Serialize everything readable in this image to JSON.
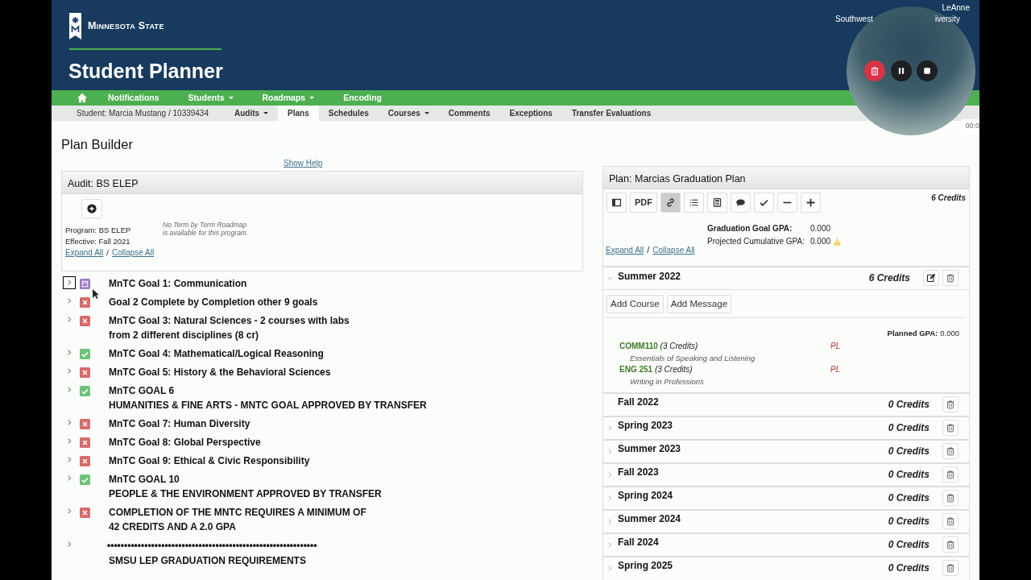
{
  "header": {
    "brand": "Minnesota State",
    "title": "Student Planner",
    "user": "LeAnne",
    "institution_left": "Southwest",
    "institution_right": "iversity"
  },
  "main_nav": [
    {
      "label": "Notifications",
      "dropdown": false
    },
    {
      "label": "Students",
      "dropdown": true
    },
    {
      "label": "Roadmaps",
      "dropdown": true
    },
    {
      "label": "Encoding",
      "dropdown": false
    }
  ],
  "student_label": "Student: Marcia Mustang / 10339434",
  "sub_nav": [
    {
      "label": "Audits",
      "dropdown": true,
      "selected": false
    },
    {
      "label": "Plans",
      "dropdown": false,
      "selected": true
    },
    {
      "label": "Schedules",
      "dropdown": false,
      "selected": false
    },
    {
      "label": "Courses",
      "dropdown": true,
      "selected": false
    },
    {
      "label": "Comments",
      "dropdown": false,
      "selected": false
    },
    {
      "label": "Exceptions",
      "dropdown": false,
      "selected": false
    },
    {
      "label": "Transfer Evaluations",
      "dropdown": false,
      "selected": false
    }
  ],
  "recorder": {
    "timer": "00:0"
  },
  "page_title": "Plan Builder",
  "show_help": "Show Help",
  "audit": {
    "title": "Audit: BS ELEP",
    "program": "Program: BS ELEP",
    "effective": "Effective: Fall 2021",
    "roadmap_note": [
      "No Term by Term Roadmap",
      "is available for this program."
    ],
    "expand_all": "Expand All",
    "collapse_all": "Collapse All",
    "separator": "/",
    "goals": [
      {
        "lines": [
          "MnTC Goal 1: Communication"
        ],
        "kind": "pending",
        "focused": true
      },
      {
        "lines": [
          "Goal 2 Complete by Completion other 9 goals"
        ],
        "kind": "unmet",
        "focused": false
      },
      {
        "lines": [
          "MnTC Goal 3: Natural Sciences - 2 courses with labs",
          "from 2 different disciplines (8 cr)"
        ],
        "kind": "unmet",
        "focused": false
      },
      {
        "lines": [
          "MnTC Goal 4: Mathematical/Logical Reasoning"
        ],
        "kind": "met",
        "focused": false
      },
      {
        "lines": [
          "MnTC Goal 5: History & the Behavioral Sciences"
        ],
        "kind": "unmet",
        "focused": false
      },
      {
        "lines": [
          "MnTC GOAL 6",
          "HUMANITIES & FINE ARTS - MNTC GOAL APPROVED BY TRANSFER"
        ],
        "kind": "met",
        "focused": false
      },
      {
        "lines": [
          "MnTC Goal 7: Human Diversity"
        ],
        "kind": "unmet",
        "focused": false
      },
      {
        "lines": [
          "MnTC Goal 8: Global Perspective"
        ],
        "kind": "unmet",
        "focused": false
      },
      {
        "lines": [
          "MnTC Goal 9: Ethical & Civic Responsibility"
        ],
        "kind": "unmet",
        "focused": false
      },
      {
        "lines": [
          "MnTC GOAL 10",
          "PEOPLE & THE ENVIRONMENT APPROVED BY TRANSFER"
        ],
        "kind": "met",
        "focused": false
      },
      {
        "lines": [
          "COMPLETION OF THE MNTC REQUIRES A MINIMUM OF",
          "42 CREDITS AND A 2.0 GPA"
        ],
        "kind": "unmet",
        "focused": false
      },
      {
        "lines": [
          "••••••••••••••••••••••••••••••••••••••••••••••••••••••••••••••",
          "SMSU LEP GRADUATION REQUIREMENTS"
        ],
        "kind": "plain",
        "focused": false
      }
    ]
  },
  "plan": {
    "title": "Plan: Marcias Graduation Plan",
    "total_credits": "6 Credits",
    "toolbar": [
      {
        "kind": "table",
        "selected": false
      },
      {
        "kind": "pdf",
        "label": "PDF",
        "selected": false
      },
      {
        "kind": "link",
        "selected": true
      },
      {
        "kind": "list",
        "selected": false
      },
      {
        "kind": "calculator",
        "selected": false
      },
      {
        "kind": "comment",
        "selected": false
      },
      {
        "kind": "check",
        "selected": false
      },
      {
        "kind": "minus",
        "selected": false
      },
      {
        "kind": "plus",
        "selected": false
      }
    ],
    "goal_gpa_label": "Graduation Goal GPA:",
    "goal_gpa": "0.000",
    "projected_gpa_label": "Projected Cumulative GPA:",
    "projected_gpa": "0.000",
    "projected_warning": true,
    "expand_all": "Expand All",
    "separator": "/",
    "collapse_all": "Collapse All",
    "terms": [
      {
        "name": "Summer 2022",
        "credits": "6 Credits",
        "expandable": true,
        "expanded": true,
        "editable": true,
        "add_course": "Add Course",
        "add_message": "Add Message",
        "planned_gpa_label": "Planned GPA:",
        "planned_gpa": "0.000",
        "courses": [
          {
            "code": "COMM110",
            "credits": "(3 Credits)",
            "title": "Essentials of Speaking and Listening",
            "grade": "PL"
          },
          {
            "code": "ENG 251",
            "credits": "(3 Credits)",
            "title": "Writing in Professions",
            "grade": "PL"
          }
        ]
      },
      {
        "name": "Fall 2022",
        "credits": "0 Credits",
        "expandable": false,
        "editable": false
      },
      {
        "name": "Spring 2023",
        "credits": "0 Credits",
        "expandable": true,
        "expanded": false,
        "editable": false
      },
      {
        "name": "Summer 2023",
        "credits": "0 Credits",
        "expandable": true,
        "expanded": false,
        "editable": false
      },
      {
        "name": "Fall 2023",
        "credits": "0 Credits",
        "expandable": true,
        "expanded": false,
        "editable": false
      },
      {
        "name": "Spring 2024",
        "credits": "0 Credits",
        "expandable": true,
        "expanded": false,
        "editable": false
      },
      {
        "name": "Summer 2024",
        "credits": "0 Credits",
        "expandable": true,
        "expanded": false,
        "editable": false
      },
      {
        "name": "Fall 2024",
        "credits": "0 Credits",
        "expandable": true,
        "expanded": false,
        "editable": false
      },
      {
        "name": "Spring 2025",
        "credits": "0 Credits",
        "expandable": true,
        "expanded": false,
        "editable": false
      }
    ]
  }
}
